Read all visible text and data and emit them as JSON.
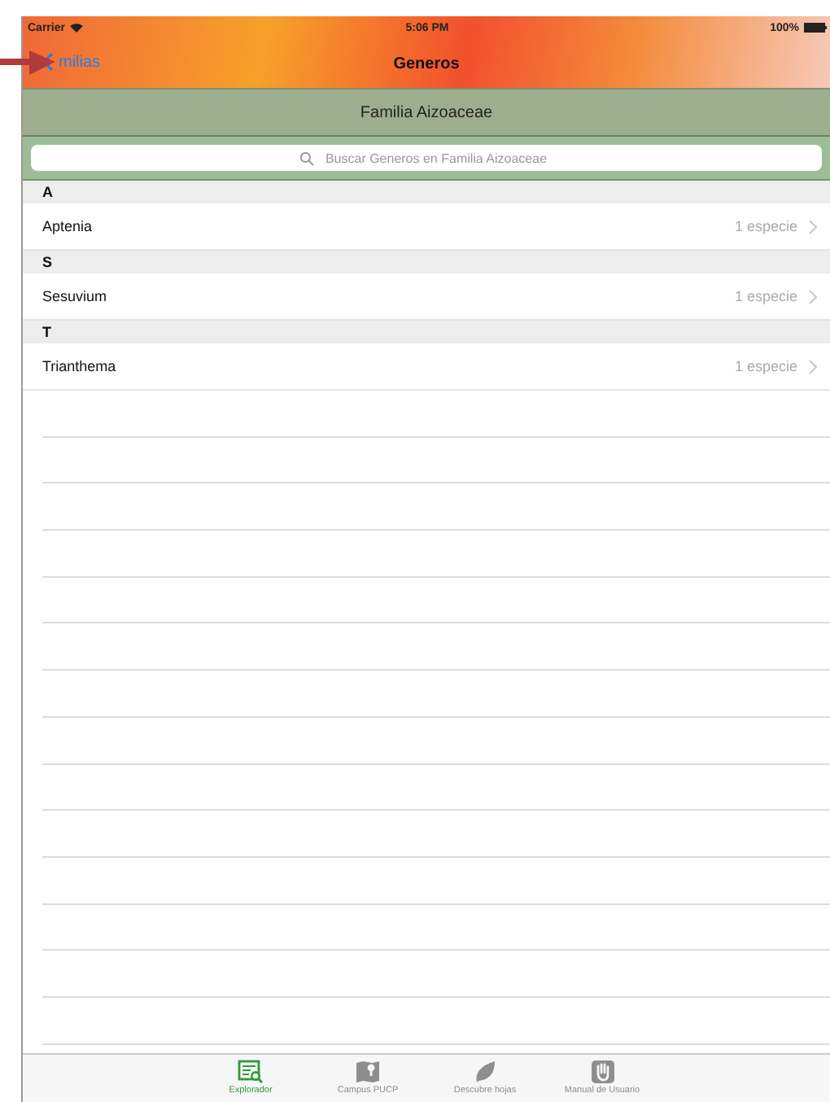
{
  "status_bar": {
    "carrier": "Carrier",
    "time": "5:06 PM",
    "battery": "100%"
  },
  "nav_bar": {
    "back": "milias",
    "title": "Generos"
  },
  "family_header": "Familia Aizoaceae",
  "search": {
    "placeholder": "Buscar Generos en Familia Aizoaceae"
  },
  "sections": [
    {
      "letter": "A",
      "rows": [
        {
          "name": "Aptenia",
          "detail": "1 especie"
        }
      ]
    },
    {
      "letter": "S",
      "rows": [
        {
          "name": "Sesuvium",
          "detail": "1 especie"
        }
      ]
    },
    {
      "letter": "T",
      "rows": [
        {
          "name": "Trianthema",
          "detail": "1 especie"
        }
      ]
    }
  ],
  "tab_bar": [
    {
      "kind": "explorer",
      "label": "Explorador",
      "selected": true
    },
    {
      "kind": "map",
      "label": "Campus PUCP",
      "selected": false
    },
    {
      "kind": "leaf",
      "label": "Descubre hojas",
      "selected": false
    },
    {
      "kind": "hand",
      "label": "Manual de Usuario",
      "selected": false
    }
  ]
}
